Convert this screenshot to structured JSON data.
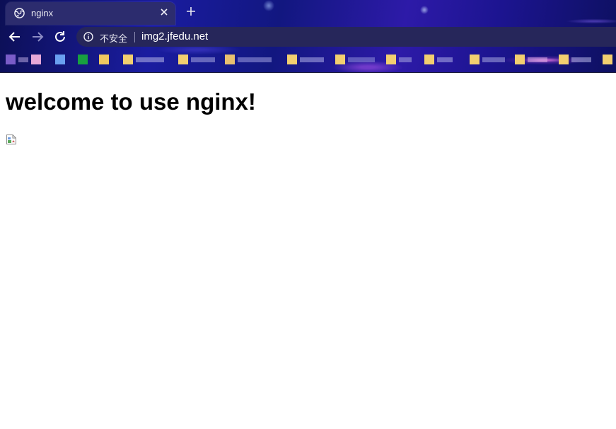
{
  "browser": {
    "tab": {
      "title": "nginx",
      "favicon": "globe-icon",
      "close_icon": "close-icon"
    },
    "new_tab_icon": "plus-icon",
    "nav": {
      "back_icon": "arrow-left-icon",
      "forward_icon": "arrow-right-icon",
      "reload_icon": "reload-icon"
    },
    "omnibox": {
      "security_icon": "info-icon",
      "security_label": "不安全",
      "url": "img2.jfedu.net"
    },
    "bookmarks_bar": {
      "note": ""
    }
  },
  "page": {
    "heading": "welcome to use nginx!",
    "image": {
      "state": "broken-image-icon"
    }
  },
  "colors": {
    "page_background": "#ffffff",
    "heading_text": "#000000",
    "tab_background": "#2c2c6e"
  }
}
